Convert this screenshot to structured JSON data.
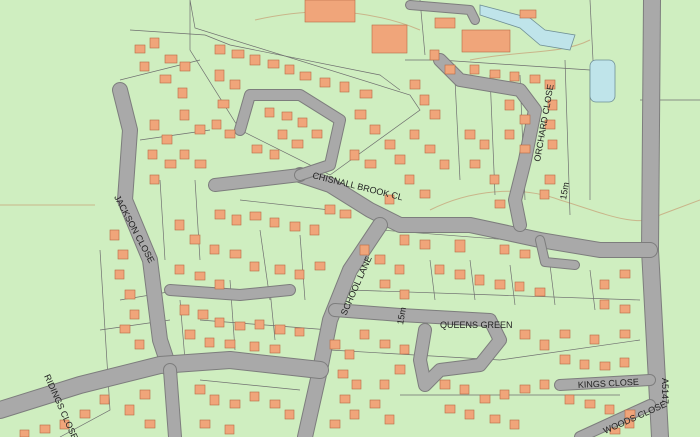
{
  "map": {
    "background": "#cfeec0",
    "building_color": "#f0a57a",
    "road_color": "#a9a9a9",
    "water_color": "#bfe4ea"
  },
  "labels": {
    "chisnall": "CHISNALL BROOK CL",
    "jackson": "JACKSON CLOSE",
    "orchard": "ORCHARD CLOSE",
    "school": "SCHOOL LANE",
    "queens": "QUEENS GREEN",
    "kings": "KINGS CLOSE",
    "woods": "WOODS CLOSE",
    "a5147": "A5147",
    "ridings": "RIDINGS CLOSE",
    "fifteen_m": "15m",
    "fifteen_m_b": "15m"
  }
}
